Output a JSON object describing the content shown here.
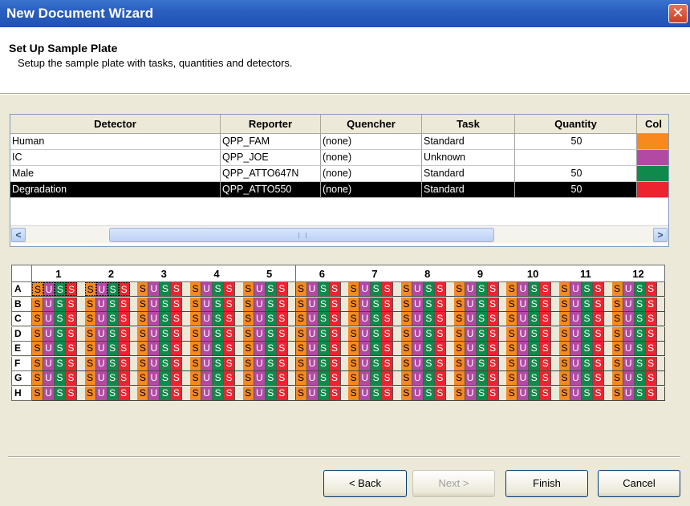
{
  "window": {
    "title": "New Document Wizard",
    "close_glyph": "✕"
  },
  "header": {
    "title": "Set Up Sample Plate",
    "subtitle": "Setup the sample plate with tasks, quantities and detectors."
  },
  "detector_table": {
    "columns": [
      "Detector",
      "Reporter",
      "Quencher",
      "Task",
      "Quantity",
      "Col"
    ],
    "rows": [
      {
        "detector": "Human",
        "reporter": "QPP_FAM",
        "quencher": "(none)",
        "task": "Standard",
        "quantity": "50",
        "color": "#f7891f",
        "selected": false
      },
      {
        "detector": "IC",
        "reporter": "QPP_JOE",
        "quencher": "(none)",
        "task": "Unknown",
        "quantity": "",
        "color": "#b24aa3",
        "selected": false
      },
      {
        "detector": "Male",
        "reporter": "QPP_ATTO647N",
        "quencher": "(none)",
        "task": "Standard",
        "quantity": "50",
        "color": "#0f8a4a",
        "selected": false
      },
      {
        "detector": "Degradation",
        "reporter": "QPP_ATTO550",
        "quencher": "(none)",
        "task": "Standard",
        "quantity": "50",
        "color": "#ee2330",
        "selected": true
      }
    ]
  },
  "scrollbar": {
    "left_glyph": "<",
    "right_glyph": ">"
  },
  "plate": {
    "columns": [
      "1",
      "2",
      "3",
      "4",
      "5",
      "6",
      "7",
      "8",
      "9",
      "10",
      "11",
      "12"
    ],
    "rows": [
      "A",
      "B",
      "C",
      "D",
      "E",
      "F",
      "G",
      "H"
    ],
    "well_letters": [
      "S",
      "U",
      "S",
      "S"
    ],
    "well_colors": [
      "orange",
      "purple",
      "green",
      "red"
    ],
    "selected_wells": [
      "A1",
      "A2"
    ]
  },
  "buttons": {
    "back": "< Back",
    "next": "Next >",
    "finish": "Finish",
    "cancel": "Cancel"
  }
}
